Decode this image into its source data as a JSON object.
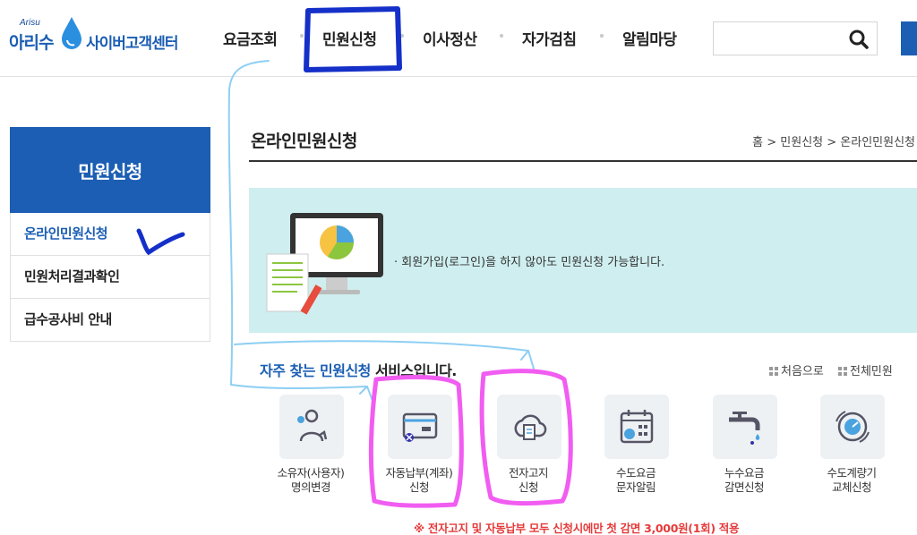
{
  "logo": {
    "sub": "Arisu",
    "name_left": "아리수",
    "name_right": "사이버고객센터"
  },
  "nav": {
    "items": [
      "요금조회",
      "민원신청",
      "이사정산",
      "자가검침",
      "알림마당"
    ]
  },
  "search": {
    "placeholder": "",
    "icon": "search-icon"
  },
  "sidebar": {
    "title": "민원신청",
    "items": [
      {
        "label": "온라인민원신청",
        "active": true
      },
      {
        "label": "민원처리결과확인",
        "active": false
      },
      {
        "label": "급수공사비 안내",
        "active": false
      }
    ]
  },
  "main": {
    "title": "온라인민원신청",
    "breadcrumb": "홈 > 민원신청 > 온라인민원신청",
    "banner_note": "· 회원가입(로그인)을 하지 않아도 민원신청 가능합니다.",
    "freq_title_highlight": "자주 찾는 민원신청",
    "freq_title_rest": " 서비스입니다.",
    "links": {
      "first": "처음으로",
      "all": "전체민원"
    },
    "services": [
      {
        "line1": "소유자(사용자)",
        "line2": "명의변경",
        "icon": "person-change-icon"
      },
      {
        "line1": "자동납부(계좌)",
        "line2": "신청",
        "icon": "card-icon"
      },
      {
        "line1": "전자고지",
        "line2": "신청",
        "icon": "cloud-document-icon"
      },
      {
        "line1": "수도요금",
        "line2": "문자알림",
        "icon": "calendar-icon"
      },
      {
        "line1": "누수요금",
        "line2": "감면신청",
        "icon": "faucet-icon"
      },
      {
        "line1": "수도계량기",
        "line2": "교체신청",
        "icon": "meter-icon"
      }
    ],
    "notice": "※ 전자고지 및 자동납부 모두 신청시에만 첫 감면 3,000원(1회) 적용"
  },
  "colors": {
    "brand": "#1b5eb3",
    "banner_bg": "#cfeeef",
    "notice": "#e53b3b",
    "annotation_blue": "#1530c8",
    "annotation_magenta": "#f15cf1",
    "annotation_cyan": "#8ecff3"
  }
}
